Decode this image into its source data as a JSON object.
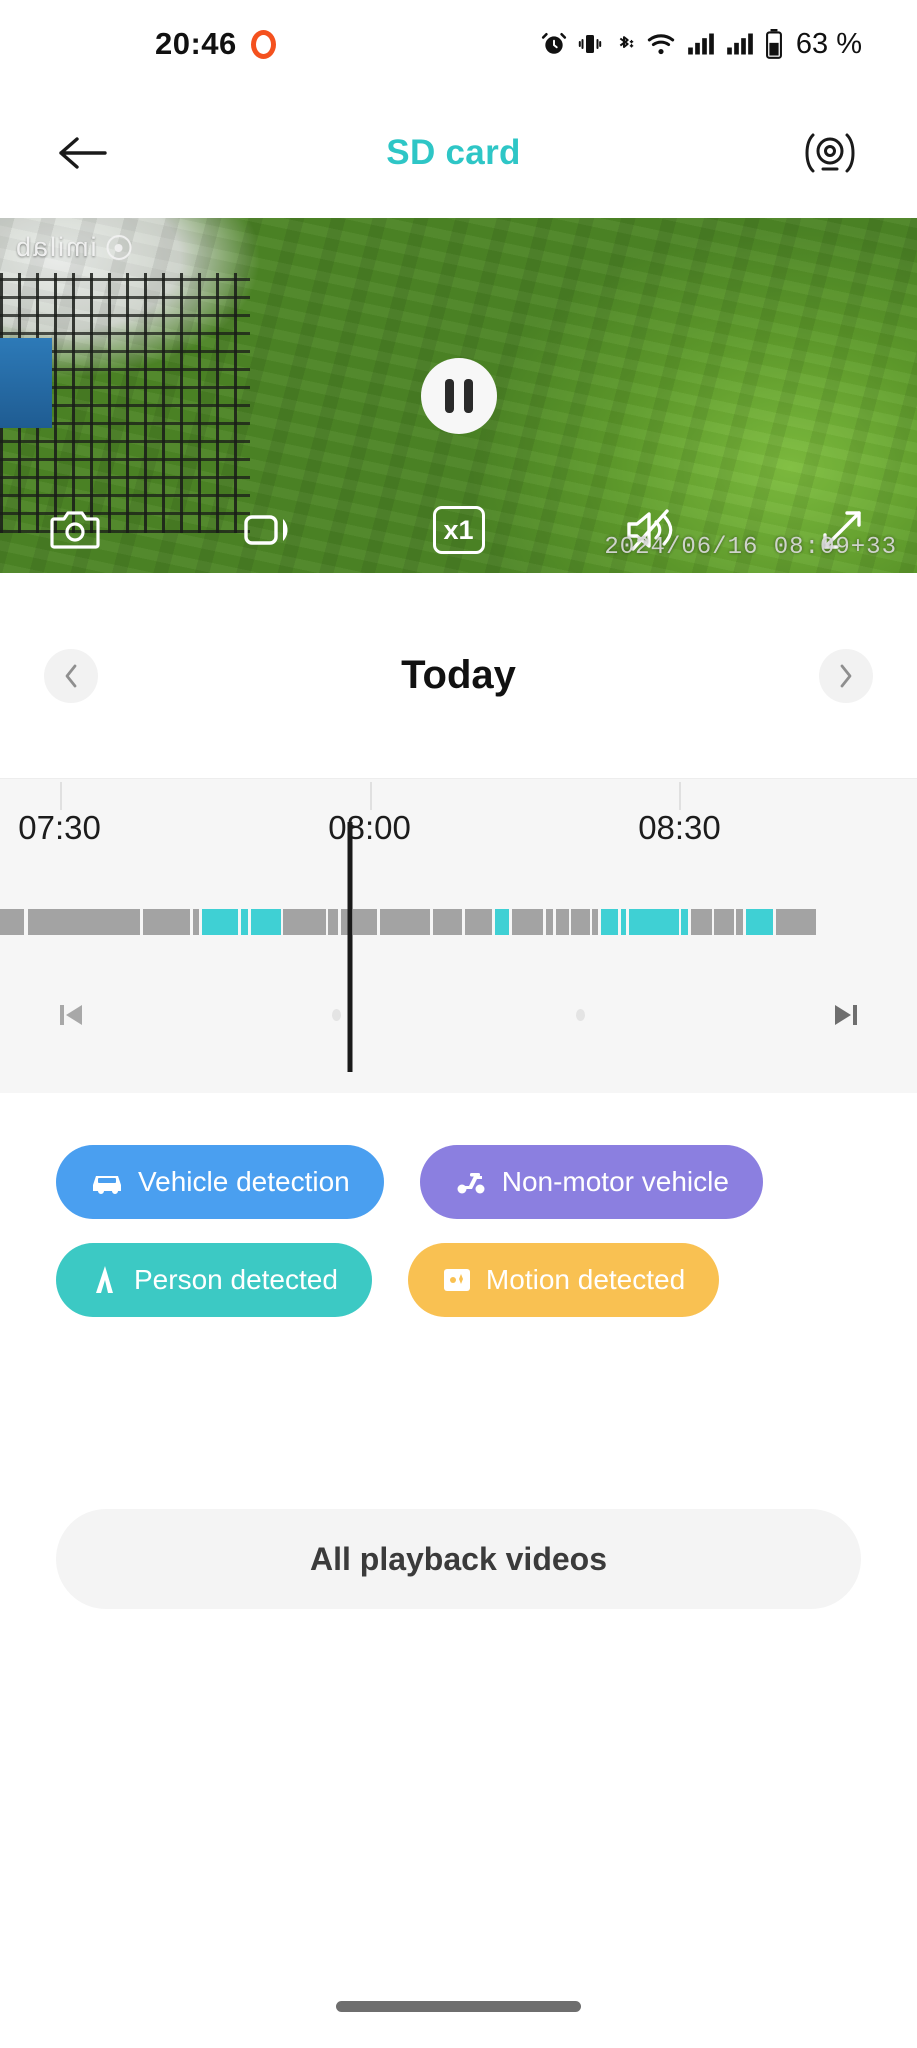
{
  "status_bar": {
    "time": "20:46",
    "battery_percent": "63 %",
    "icons": [
      "ring-indicator-icon",
      "alarm-icon",
      "vibrate-icon",
      "bluetooth-icon",
      "wifi-icon",
      "signal-icon-1",
      "signal-icon-2",
      "battery-icon"
    ]
  },
  "app_bar": {
    "back_icon": "back-arrow-icon",
    "title": "SD card",
    "title_color": "#2ec6c6",
    "right_icon": "camera-lens-icon"
  },
  "video": {
    "watermark": "imilab",
    "timestamp": "2024/06/16 08:09+33",
    "playing_state": "playing",
    "center_button": "pause-button",
    "controls": [
      {
        "name": "snapshot-button",
        "icon": "camera-icon",
        "label": ""
      },
      {
        "name": "record-button",
        "icon": "video-camera-icon",
        "label": ""
      },
      {
        "name": "speed-button",
        "icon": "speed-icon",
        "label": "x1"
      },
      {
        "name": "mute-button",
        "icon": "speaker-muted-icon",
        "label": ""
      },
      {
        "name": "fullscreen-button",
        "icon": "expand-icon",
        "label": ""
      }
    ]
  },
  "day_nav": {
    "prev_icon": "chevron-left-icon",
    "title": "Today",
    "next_icon": "chevron-right-icon"
  },
  "timeline": {
    "tick_labels": [
      "07:30",
      "08:00",
      "08:30"
    ],
    "tick_positions_pct": [
      6.5,
      40.3,
      74.1
    ],
    "playhead_pct": 38.2,
    "prev_event_icon": "skip-previous-icon",
    "next_event_icon": "skip-next-icon",
    "colors": {
      "normal": "#a3a3a3",
      "event": "#3fd0d4",
      "playhead": "#1a1a1a",
      "background": "#f6f6f6"
    },
    "segments": [
      {
        "start_pct": 0.0,
        "width_pct": 2.6,
        "type": "normal"
      },
      {
        "start_pct": 3.0,
        "width_pct": 12.3,
        "type": "normal"
      },
      {
        "start_pct": 15.6,
        "width_pct": 5.1,
        "type": "normal"
      },
      {
        "start_pct": 21.0,
        "width_pct": 0.7,
        "type": "normal"
      },
      {
        "start_pct": 22.0,
        "width_pct": 4.0,
        "type": "event"
      },
      {
        "start_pct": 26.3,
        "width_pct": 0.8,
        "type": "event"
      },
      {
        "start_pct": 27.4,
        "width_pct": 3.2,
        "type": "event"
      },
      {
        "start_pct": 30.9,
        "width_pct": 4.6,
        "type": "normal"
      },
      {
        "start_pct": 35.8,
        "width_pct": 1.1,
        "type": "normal"
      },
      {
        "start_pct": 37.2,
        "width_pct": 1.0,
        "type": "normal"
      },
      {
        "start_pct": 38.5,
        "width_pct": 2.6,
        "type": "normal"
      },
      {
        "start_pct": 41.4,
        "width_pct": 5.5,
        "type": "normal"
      },
      {
        "start_pct": 47.2,
        "width_pct": 3.2,
        "type": "normal"
      },
      {
        "start_pct": 50.7,
        "width_pct": 3.0,
        "type": "normal"
      },
      {
        "start_pct": 54.0,
        "width_pct": 1.5,
        "type": "event"
      },
      {
        "start_pct": 55.8,
        "width_pct": 3.4,
        "type": "normal"
      },
      {
        "start_pct": 59.5,
        "width_pct": 0.8,
        "type": "normal"
      },
      {
        "start_pct": 60.6,
        "width_pct": 1.4,
        "type": "normal"
      },
      {
        "start_pct": 62.3,
        "width_pct": 2.0,
        "type": "normal"
      },
      {
        "start_pct": 64.6,
        "width_pct": 0.6,
        "type": "normal"
      },
      {
        "start_pct": 65.5,
        "width_pct": 1.9,
        "type": "event"
      },
      {
        "start_pct": 67.7,
        "width_pct": 0.6,
        "type": "event"
      },
      {
        "start_pct": 68.6,
        "width_pct": 5.4,
        "type": "event"
      },
      {
        "start_pct": 74.3,
        "width_pct": 0.7,
        "type": "event"
      },
      {
        "start_pct": 75.3,
        "width_pct": 2.3,
        "type": "normal"
      },
      {
        "start_pct": 77.9,
        "width_pct": 2.1,
        "type": "normal"
      },
      {
        "start_pct": 80.3,
        "width_pct": 0.7,
        "type": "normal"
      },
      {
        "start_pct": 81.3,
        "width_pct": 3.0,
        "type": "event"
      },
      {
        "start_pct": 84.6,
        "width_pct": 4.4,
        "type": "normal"
      }
    ]
  },
  "filters": [
    {
      "label": "Vehicle detection",
      "color": "#4a9ff0",
      "icon": "car-icon",
      "name": "filter-vehicle-detection"
    },
    {
      "label": "Non-motor vehicle",
      "color": "#8b7fe0",
      "icon": "scooter-icon",
      "name": "filter-non-motor-vehicle"
    },
    {
      "label": "Person detected",
      "color": "#3cc9c4",
      "icon": "person-icon",
      "name": "filter-person-detected"
    },
    {
      "label": "Motion detected",
      "color": "#f9c152",
      "icon": "motion-icon",
      "name": "filter-motion-detected"
    }
  ],
  "all_playback": {
    "label": "All playback videos"
  }
}
